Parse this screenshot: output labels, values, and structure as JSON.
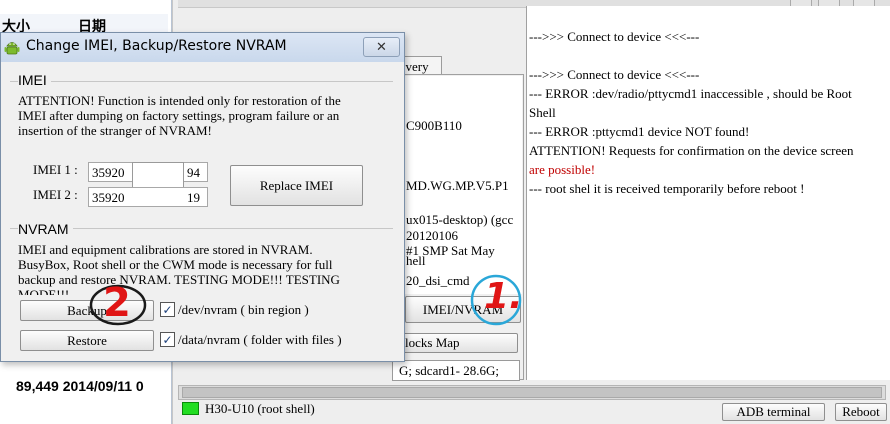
{
  "explorer": {
    "col_size": "大小",
    "col_date": "日期",
    "row_text": "89,449 2014/09/11 0"
  },
  "app": {
    "tab_label": "overy",
    "info_lines": [
      "C900B110",
      "MD.WG.MP.V5.P1",
      "ux015-desktop) (gcc",
      "20120106",
      "#1 SMP  Sat May",
      "hell",
      "20_dsi_cmd"
    ],
    "imei_nvram_button": "IMEI/NVRAM",
    "blocks_button": "locks Map",
    "storage_text": "G; sdcard1- 28.6G;"
  },
  "console": {
    "lines": [
      {
        "text": "--->>> Connect to device <<<---",
        "color": "#000000"
      },
      {
        "text": "",
        "color": "#000000"
      },
      {
        "text": "--->>> Connect to device <<<---",
        "color": "#000000"
      },
      {
        "text": " --- ERROR  :dev/radio/pttycmd1 inaccessible , should be  Root",
        "color": "#000000"
      },
      {
        "text": "Shell",
        "color": "#000000"
      },
      {
        "text": " --- ERROR  :pttycmd1 device NOT found!",
        "color": "#000000"
      },
      {
        "text": "ATTENTION! Requests for confirmation on the device screen",
        "color": "#000000"
      },
      {
        "text": "are possible!",
        "color": "#c00000"
      },
      {
        "text": " --- root shel it is received temporarily before reboot !",
        "color": "#000000"
      }
    ]
  },
  "status": {
    "led_color": "#22dd22",
    "device_text": "H30-U10 (root shell)",
    "adb_button": "ADB terminal",
    "reboot_button": "Reboot"
  },
  "dialog": {
    "title": "Change IMEI, Backup/Restore NVRAM",
    "close_glyph": "✕",
    "imei_group": {
      "label": "IMEI",
      "warning_lines": [
        "ATTENTION! Function is intended only for restoration of the",
        "IMEI after dumping on factory settings, program failure or an",
        "insertion of the stranger of NVRAM!"
      ],
      "imei1_label": "IMEI 1 :",
      "imei1_prefix": "35920",
      "imei1_suffix": "94",
      "imei2_label": "IMEI 2 :",
      "imei2_prefix": "35920",
      "imei2_suffix": "19",
      "replace_button": "Replace IMEI"
    },
    "nvram_group": {
      "label": "NVRAM",
      "info_lines": [
        "IMEI and equipment calibrations are stored in NVRAM.",
        "BusyBox, Root shell or the CWM mode is necessary for full",
        "backup and restore NVRAM. TESTING MODE!!!  TESTING",
        "MODE!!!"
      ],
      "backup_button": "Backup",
      "restore_button": "Restore",
      "backup_check_label": "/dev/nvram  ( bin region )",
      "restore_check_label": "/data/nvram  ( folder with files )",
      "backup_checked": true,
      "restore_checked": true,
      "check_glyph": "✓"
    }
  },
  "annotations": {
    "step1_label": "1.",
    "step1_circle_color": "#2aa7d8",
    "step1_text_color": "#e01515",
    "step2_label": "2",
    "step2_text_color": "#e01515"
  }
}
